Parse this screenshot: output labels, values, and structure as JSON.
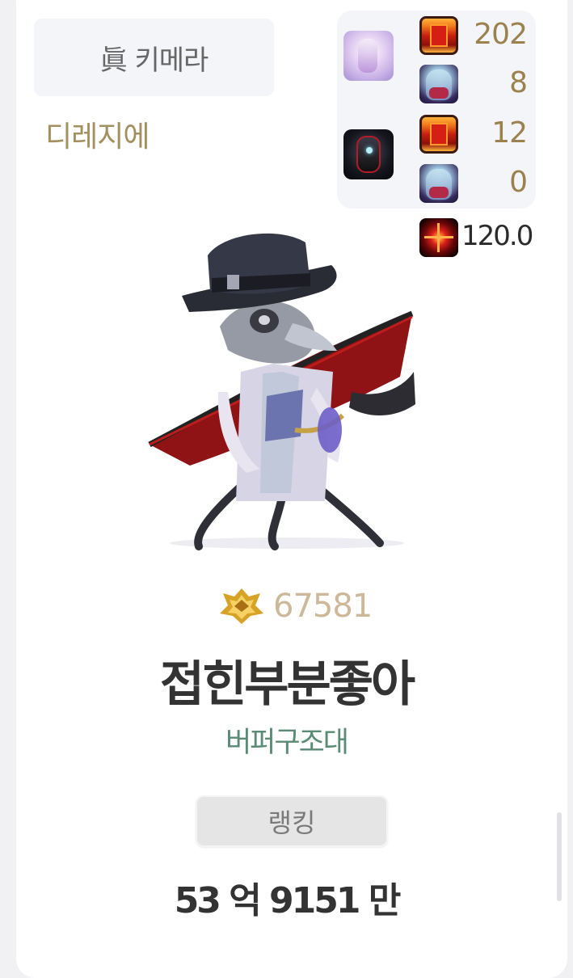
{
  "job": {
    "title": "眞 키메라"
  },
  "server": {
    "name": "디레지에"
  },
  "buff_stats": [
    {
      "avatar_icon": "blessing-character-avatar-icon",
      "scroll_value": "202",
      "character_value": "8"
    },
    {
      "avatar_icon": "dark-knight-avatar-icon",
      "scroll_value": "12",
      "character_value": "0"
    }
  ],
  "critical": {
    "icon": "crosshair-target-icon",
    "value": "120.0"
  },
  "fame": {
    "icon": "gold-emblem-icon",
    "value": "67581"
  },
  "character": {
    "name": "접힌부분좋아",
    "guild": "버퍼구조대"
  },
  "ranking": {
    "label": "랭킹"
  },
  "damage": {
    "value": "53 억 9151 만"
  },
  "colors": {
    "server_gold": "#a48f5e",
    "stat_gold": "#9b814d",
    "fame_tan": "#cdb99a",
    "guild_green": "#5a8b75",
    "name_dark": "#333333"
  }
}
